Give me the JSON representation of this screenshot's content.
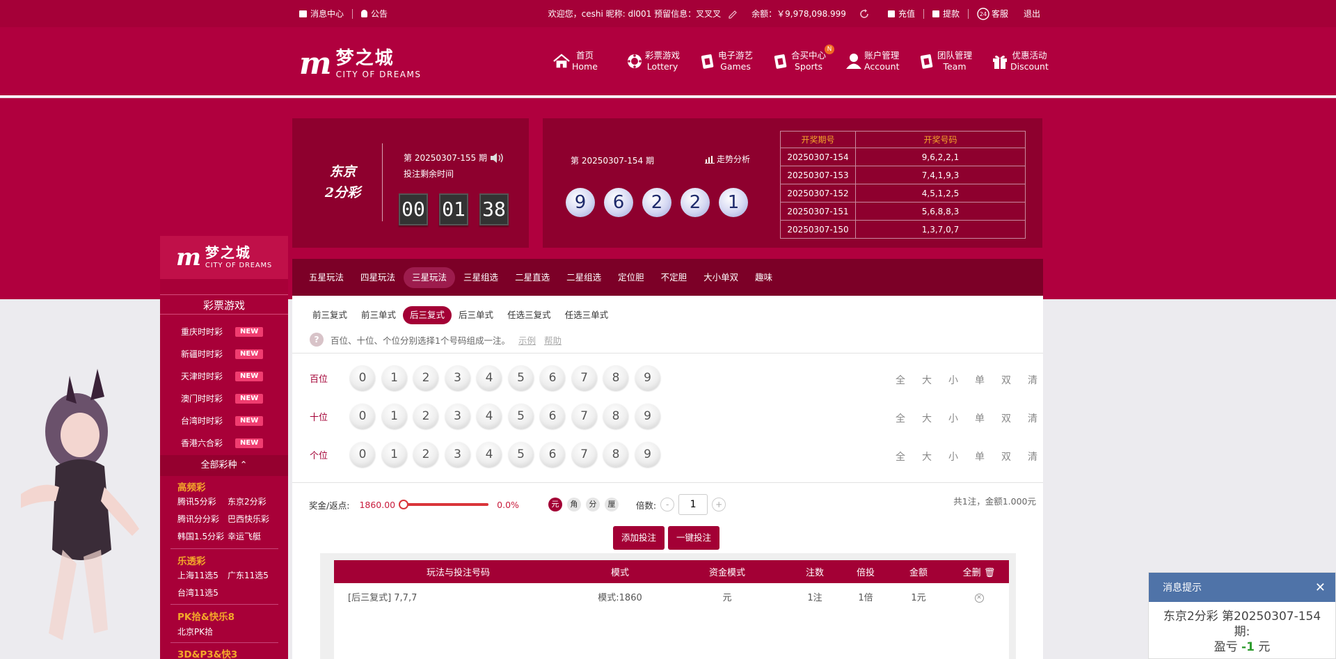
{
  "topbar": {
    "messages": "消息中心",
    "notice": "公告",
    "welcome": "欢迎您，ceshi 昵称: dl001 预留信息：叉叉叉",
    "balance_label": "余额：",
    "balance": "￥9,978,098.999",
    "recharge": "充值",
    "withdraw": "提款",
    "service": "客服",
    "logout": "退出"
  },
  "brand": {
    "cn": "梦之城",
    "en": "CITY OF DREAMS",
    "mark": "m"
  },
  "nav": [
    {
      "cn": "首页",
      "en": "Home",
      "icon": "home-icon"
    },
    {
      "cn": "彩票游戏",
      "en": "Lottery",
      "icon": "lottery-icon"
    },
    {
      "cn": "电子游艺",
      "en": "Games",
      "icon": "cards-icon"
    },
    {
      "cn": "合买中心",
      "en": "Sports",
      "icon": "cards-icon",
      "badge": "N"
    },
    {
      "cn": "账户管理",
      "en": "Account",
      "icon": "user-icon"
    },
    {
      "cn": "团队管理",
      "en": "Team",
      "icon": "cards-icon"
    },
    {
      "cn": "优惠活动",
      "en": "Discount",
      "icon": "gift-icon"
    }
  ],
  "game": {
    "name_line1": "东京",
    "name_line2": "2分彩",
    "current_period": "第 20250307-155 期",
    "remaining_label": "投注剩余时间",
    "timer": [
      "00",
      "01",
      "38"
    ],
    "last_period": "第 20250307-154 期",
    "trend": "走势分析",
    "last_numbers": [
      "9",
      "6",
      "2",
      "2",
      "1"
    ]
  },
  "results": {
    "headers": [
      "开奖期号",
      "开奖号码"
    ],
    "rows": [
      [
        "20250307-154",
        "9,6,2,2,1"
      ],
      [
        "20250307-153",
        "7,4,1,9,3"
      ],
      [
        "20250307-152",
        "4,5,1,2,5"
      ],
      [
        "20250307-151",
        "5,6,8,8,3"
      ],
      [
        "20250307-150",
        "1,3,7,0,7"
      ]
    ]
  },
  "tabs": [
    "五星玩法",
    "四星玩法",
    "三星玩法",
    "三星组选",
    "二星直选",
    "二星组选",
    "定位胆",
    "不定胆",
    "大小单双",
    "趣味"
  ],
  "subtabs": [
    "前三复式",
    "前三单式",
    "后三复式",
    "后三单式",
    "任选三复式",
    "任选三单式"
  ],
  "hint": {
    "text": "百位、十位、个位分别选择1个号码组成一注。",
    "example": "示例",
    "help": "帮助"
  },
  "positions": [
    "百位",
    "十位",
    "个位"
  ],
  "digits": [
    "0",
    "1",
    "2",
    "3",
    "4",
    "5",
    "6",
    "7",
    "8",
    "9"
  ],
  "quick": [
    "全",
    "大",
    "小",
    "单",
    "双",
    "清"
  ],
  "bet": {
    "bonus_label": "奖金/返点:",
    "bonus_value": "1860.00",
    "rebate": "0.0%",
    "rebate_level": 0,
    "units": [
      "元",
      "角",
      "分",
      "厘"
    ],
    "multiplier_label": "倍数:",
    "multiplier": "1",
    "minus": "-",
    "plus": "+",
    "summary": "共1注，金额1.000元",
    "add": "添加投注",
    "quick_bet": "一键投注"
  },
  "cart": {
    "headers": [
      "玩法与投注号码",
      "模式",
      "资金模式",
      "注数",
      "倍投",
      "金额",
      "全删"
    ],
    "rows": [
      [
        "[后三复式] 7,7,7",
        "模式:1860",
        "元",
        "1注",
        "1倍",
        "1元"
      ]
    ]
  },
  "sidebar": {
    "title": "彩票游戏",
    "new_label": "NEW",
    "hot": [
      "重庆时时彩",
      "新疆时时彩",
      "天津时时彩",
      "澳门时时彩",
      "台湾时时彩",
      "香港六合彩"
    ],
    "all": "全部彩种",
    "cats": [
      {
        "name": "高频彩",
        "links": [
          [
            "腾讯5分彩",
            "东京2分彩"
          ],
          [
            "腾讯分分彩",
            "巴西快乐彩"
          ],
          [
            "韩国1.5分彩",
            "幸运飞艇"
          ]
        ]
      },
      {
        "name": "乐透彩",
        "links": [
          [
            "上海11选5",
            "广东11选5"
          ],
          [
            "台湾11选5"
          ]
        ]
      },
      {
        "name": "PK拾&快乐8",
        "links": [
          [
            "北京PK拾"
          ]
        ]
      },
      {
        "name": "3D&P3&快3",
        "links": []
      }
    ]
  },
  "toast": {
    "title": "消息提示",
    "line1": "东京2分彩 第20250307-154期:",
    "loss_label": "盈亏",
    "loss_value": "-1",
    "loss_unit": "元"
  },
  "colors": {
    "brand": "#b0003e",
    "dark": "#8e002e",
    "accent": "#f3a82a",
    "toast": "#4f73a8"
  }
}
